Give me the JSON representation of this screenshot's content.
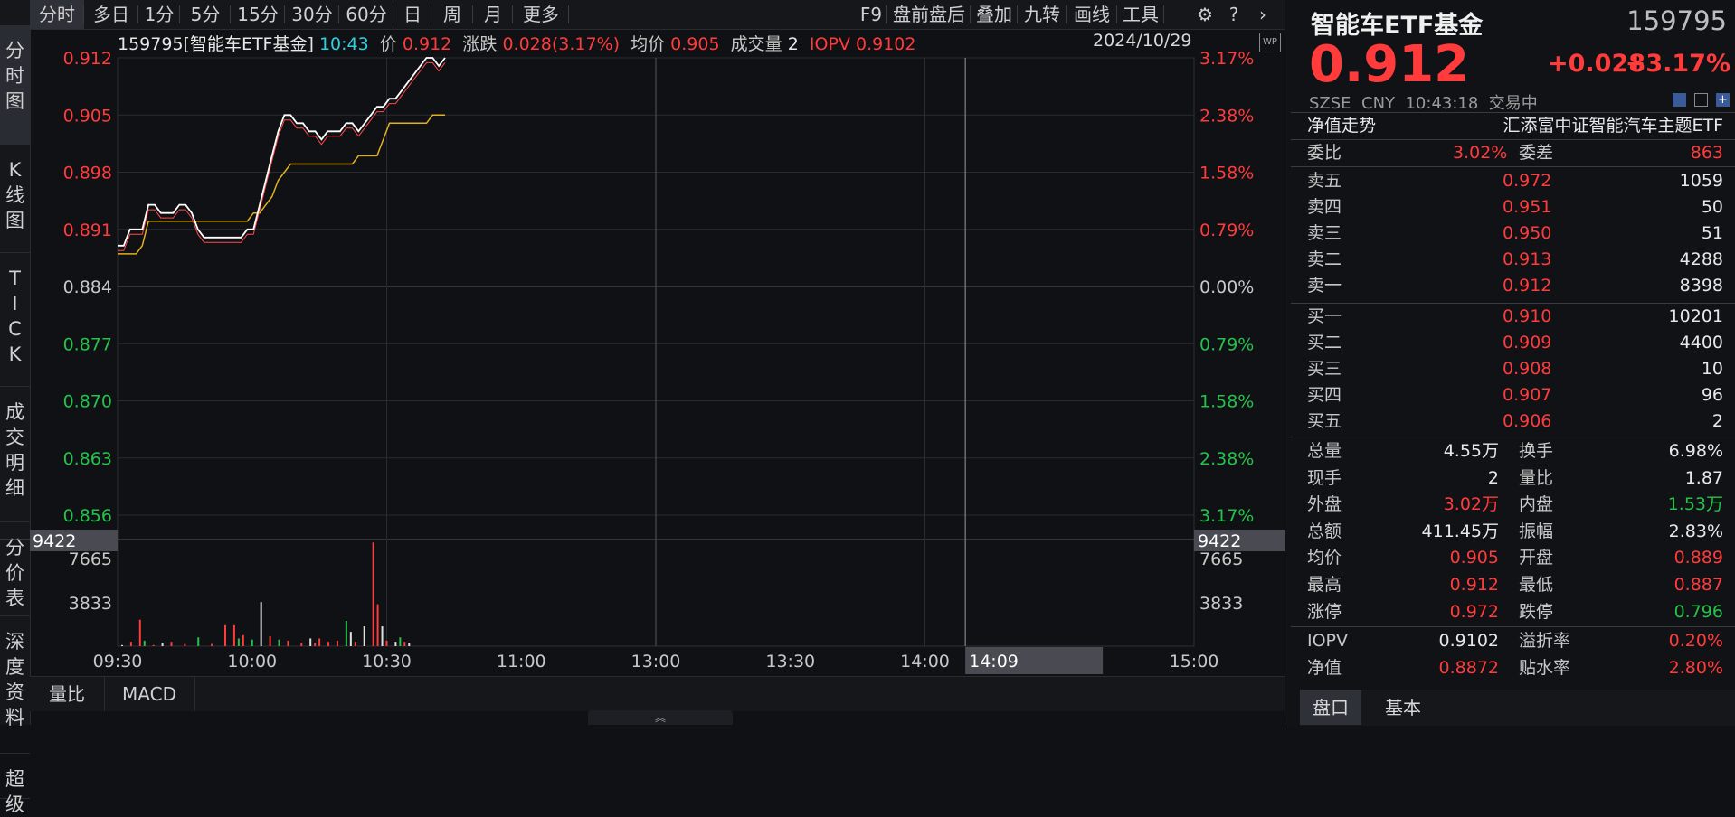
{
  "left_nav": [
    {
      "label": "分\n时\n图",
      "active": true
    },
    {
      "label": "K\n线\n图",
      "active": false
    },
    {
      "label": "T\nI\nC\nK",
      "active": false
    },
    {
      "label": "成\n交\n明\n细",
      "active": false
    },
    {
      "label": "分\n价\n表",
      "active": false
    },
    {
      "label": "深\n度\n资\n料",
      "active": false
    },
    {
      "label": "超\n级",
      "active": false
    }
  ],
  "top_tabs": [
    "分时",
    "多日",
    "1分",
    "5分",
    "15分",
    "30分",
    "60分",
    "日",
    "周",
    "月",
    "更多"
  ],
  "top_tools": [
    "F9",
    "盘前盘后",
    "叠加",
    "九转",
    "画线",
    "工具"
  ],
  "info": {
    "code_name": "159795[智能车ETF基金]",
    "time": "10:43",
    "price_label": "价",
    "price": "0.912",
    "change_label": "涨跌",
    "change": "0.028(3.17%)",
    "avg_label": "均价",
    "avg": "0.905",
    "vol_label": "成交量",
    "vol": "2",
    "iopv_label": "IOPV",
    "iopv": "0.9102",
    "date": "2024/10/29"
  },
  "wp_badge": "WP",
  "chart_data": {
    "type": "line",
    "price_axis": [
      {
        "v": "0.912",
        "pct": "3.17%",
        "c": "red"
      },
      {
        "v": "0.905",
        "pct": "2.38%",
        "c": "red"
      },
      {
        "v": "0.898",
        "pct": "1.58%",
        "c": "red"
      },
      {
        "v": "0.891",
        "pct": "0.79%",
        "c": "red"
      },
      {
        "v": "0.884",
        "pct": "0.00%",
        "c": "gray"
      },
      {
        "v": "0.877",
        "pct": "0.79%",
        "c": "green"
      },
      {
        "v": "0.870",
        "pct": "1.58%",
        "c": "green"
      },
      {
        "v": "0.863",
        "pct": "2.38%",
        "c": "green"
      },
      {
        "v": "0.856",
        "pct": "3.17%",
        "c": "green"
      }
    ],
    "ylim": [
      0.856,
      0.912
    ],
    "vol_axis": [
      "9422",
      "7665",
      "3833"
    ],
    "vol_max": 9422,
    "x_labels": [
      "09:30",
      "10:00",
      "10:30",
      "11:00",
      "13:00",
      "13:30",
      "14:00",
      "14:09",
      "15:00"
    ],
    "price_series": [
      [
        0,
        0.889
      ],
      [
        1,
        0.889
      ],
      [
        2,
        0.891
      ],
      [
        3,
        0.891
      ],
      [
        4,
        0.891
      ],
      [
        5,
        0.894
      ],
      [
        6,
        0.894
      ],
      [
        7,
        0.893
      ],
      [
        8,
        0.893
      ],
      [
        9,
        0.893
      ],
      [
        10,
        0.894
      ],
      [
        11,
        0.894
      ],
      [
        12,
        0.893
      ],
      [
        13,
        0.891
      ],
      [
        14,
        0.89
      ],
      [
        15,
        0.89
      ],
      [
        16,
        0.89
      ],
      [
        17,
        0.89
      ],
      [
        18,
        0.89
      ],
      [
        19,
        0.89
      ],
      [
        20,
        0.89
      ],
      [
        21,
        0.891
      ],
      [
        22,
        0.891
      ],
      [
        23,
        0.894
      ],
      [
        24,
        0.897
      ],
      [
        25,
        0.9
      ],
      [
        26,
        0.903
      ],
      [
        27,
        0.905
      ],
      [
        28,
        0.905
      ],
      [
        29,
        0.904
      ],
      [
        30,
        0.904
      ],
      [
        31,
        0.903
      ],
      [
        32,
        0.903
      ],
      [
        33,
        0.902
      ],
      [
        34,
        0.903
      ],
      [
        35,
        0.903
      ],
      [
        36,
        0.903
      ],
      [
        37,
        0.904
      ],
      [
        38,
        0.904
      ],
      [
        39,
        0.903
      ],
      [
        40,
        0.904
      ],
      [
        41,
        0.905
      ],
      [
        42,
        0.906
      ],
      [
        43,
        0.906
      ],
      [
        44,
        0.907
      ],
      [
        45,
        0.907
      ],
      [
        46,
        0.908
      ],
      [
        47,
        0.909
      ],
      [
        48,
        0.91
      ],
      [
        49,
        0.911
      ],
      [
        50,
        0.912
      ],
      [
        51,
        0.912
      ],
      [
        52,
        0.911
      ],
      [
        53,
        0.912
      ]
    ],
    "avg_series": [
      [
        0,
        0.888
      ],
      [
        1,
        0.888
      ],
      [
        2,
        0.888
      ],
      [
        3,
        0.888
      ],
      [
        4,
        0.889
      ],
      [
        5,
        0.892
      ],
      [
        6,
        0.892
      ],
      [
        7,
        0.892
      ],
      [
        8,
        0.892
      ],
      [
        9,
        0.892
      ],
      [
        10,
        0.892
      ],
      [
        11,
        0.892
      ],
      [
        12,
        0.892
      ],
      [
        13,
        0.892
      ],
      [
        14,
        0.892
      ],
      [
        15,
        0.892
      ],
      [
        16,
        0.892
      ],
      [
        17,
        0.892
      ],
      [
        18,
        0.892
      ],
      [
        19,
        0.892
      ],
      [
        20,
        0.892
      ],
      [
        21,
        0.892
      ],
      [
        22,
        0.893
      ],
      [
        23,
        0.893
      ],
      [
        24,
        0.894
      ],
      [
        25,
        0.895
      ],
      [
        26,
        0.897
      ],
      [
        27,
        0.898
      ],
      [
        28,
        0.899
      ],
      [
        29,
        0.899
      ],
      [
        30,
        0.899
      ],
      [
        31,
        0.899
      ],
      [
        32,
        0.899
      ],
      [
        33,
        0.899
      ],
      [
        34,
        0.899
      ],
      [
        35,
        0.899
      ],
      [
        36,
        0.899
      ],
      [
        37,
        0.899
      ],
      [
        38,
        0.899
      ],
      [
        39,
        0.9
      ],
      [
        40,
        0.9
      ],
      [
        41,
        0.9
      ],
      [
        42,
        0.9
      ],
      [
        43,
        0.902
      ],
      [
        44,
        0.904
      ],
      [
        45,
        0.904
      ],
      [
        46,
        0.904
      ],
      [
        47,
        0.904
      ],
      [
        48,
        0.904
      ],
      [
        49,
        0.904
      ],
      [
        50,
        0.904
      ],
      [
        51,
        0.905
      ],
      [
        52,
        0.905
      ],
      [
        53,
        0.905
      ]
    ],
    "vol_bars": [
      [
        1,
        0,
        100
      ],
      [
        3,
        1,
        400
      ],
      [
        5,
        1,
        2400
      ],
      [
        6,
        0,
        500
      ],
      [
        8,
        1,
        100
      ],
      [
        10,
        0,
        300
      ],
      [
        12,
        1,
        400
      ],
      [
        15,
        1,
        200
      ],
      [
        18,
        0,
        800
      ],
      [
        21,
        1,
        200
      ],
      [
        24,
        1,
        1900
      ],
      [
        26,
        1,
        1900
      ],
      [
        27,
        0,
        700
      ],
      [
        28,
        1,
        1000
      ],
      [
        30,
        0,
        600
      ],
      [
        32,
        0,
        4000
      ],
      [
        34,
        1,
        900
      ],
      [
        36,
        0,
        600
      ],
      [
        38,
        1,
        500
      ],
      [
        41,
        1,
        300
      ],
      [
        43,
        0,
        700
      ],
      [
        44,
        1,
        300
      ],
      [
        45,
        1,
        700
      ],
      [
        47,
        1,
        400
      ],
      [
        49,
        1,
        500
      ],
      [
        51,
        0,
        2300
      ],
      [
        52,
        0,
        1300
      ],
      [
        53,
        1,
        400
      ],
      [
        55,
        0,
        1800
      ],
      [
        57,
        1,
        9400
      ],
      [
        58,
        1,
        3800
      ],
      [
        59,
        0,
        1800
      ],
      [
        60,
        1,
        500
      ],
      [
        62,
        0,
        400
      ],
      [
        63,
        0,
        800
      ],
      [
        64,
        1,
        400
      ],
      [
        65,
        0,
        300
      ]
    ]
  },
  "vol_label_left": "9422",
  "vol_label_right": "9422",
  "cursor_time": "14:09",
  "bottom_tabs": [
    "量比",
    "MACD"
  ],
  "right_panel": {
    "name": "智能车ETF基金",
    "code": "159795",
    "price": "0.912",
    "change": "+0.028",
    "change_pct": "+3.17%",
    "sub": "SZSE  CNY  10:43:18  交易中",
    "nav_trend_label": "净值走势",
    "fund_full_name": "汇添富中证智能汽车主题ETF",
    "weibi_label": "委比",
    "weibi": "3.02%",
    "weicha_label": "委差",
    "weicha": "863",
    "asks": [
      {
        "label": "卖五",
        "price": "0.972",
        "vol": "1059"
      },
      {
        "label": "卖四",
        "price": "0.951",
        "vol": "50"
      },
      {
        "label": "卖三",
        "price": "0.950",
        "vol": "51"
      },
      {
        "label": "卖二",
        "price": "0.913",
        "vol": "4288"
      },
      {
        "label": "卖一",
        "price": "0.912",
        "vol": "8398"
      }
    ],
    "bids": [
      {
        "label": "买一",
        "price": "0.910",
        "vol": "10201"
      },
      {
        "label": "买二",
        "price": "0.909",
        "vol": "4400"
      },
      {
        "label": "买三",
        "price": "0.908",
        "vol": "10"
      },
      {
        "label": "买四",
        "price": "0.907",
        "vol": "96"
      },
      {
        "label": "买五",
        "price": "0.906",
        "vol": "2"
      }
    ],
    "stats": [
      {
        "l1": "总量",
        "v1": "4.55万",
        "c1": "white",
        "l2": "换手",
        "v2": "6.98%",
        "c2": "white"
      },
      {
        "l1": "现手",
        "v1": "2",
        "c1": "white",
        "l2": "量比",
        "v2": "1.87",
        "c2": "white"
      },
      {
        "l1": "外盘",
        "v1": "3.02万",
        "c1": "red",
        "l2": "内盘",
        "v2": "1.53万",
        "c2": "green"
      },
      {
        "l1": "总额",
        "v1": "411.45万",
        "c1": "white",
        "l2": "振幅",
        "v2": "2.83%",
        "c2": "white"
      },
      {
        "l1": "均价",
        "v1": "0.905",
        "c1": "red",
        "l2": "开盘",
        "v2": "0.889",
        "c2": "red"
      },
      {
        "l1": "最高",
        "v1": "0.912",
        "c1": "red",
        "l2": "最低",
        "v2": "0.887",
        "c2": "red"
      },
      {
        "l1": "涨停",
        "v1": "0.972",
        "c1": "red",
        "l2": "跌停",
        "v2": "0.796",
        "c2": "green"
      }
    ],
    "iopv_rows": [
      {
        "l1": "IOPV",
        "v1": "0.9102",
        "c1": "white",
        "l2": "溢折率",
        "v2": "0.20%",
        "c2": "red"
      },
      {
        "l1": "净值",
        "v1": "0.8872",
        "c1": "red",
        "l2": "贴水率",
        "v2": "2.80%",
        "c2": "red"
      }
    ],
    "tabs": [
      "盘口",
      "基本"
    ]
  }
}
